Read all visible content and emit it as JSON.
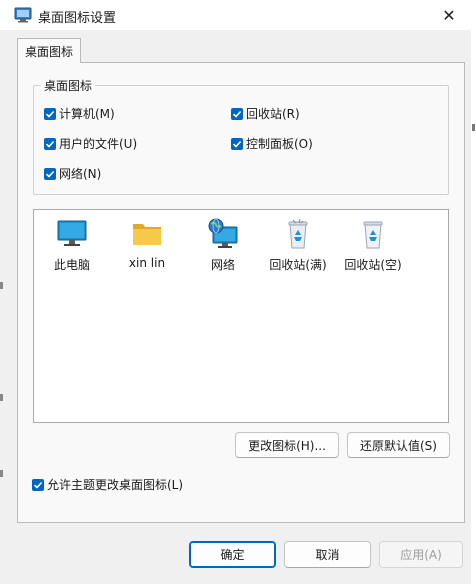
{
  "window": {
    "title": "桌面图标设置",
    "close_glyph": "✕"
  },
  "tabs": [
    {
      "label": "桌面图标"
    }
  ],
  "desktop_icons_group": {
    "legend": "桌面图标",
    "checkboxes": [
      {
        "label": "计算机(M)",
        "checked": true
      },
      {
        "label": "回收站(R)",
        "checked": true
      },
      {
        "label": "用户的文件(U)",
        "checked": true
      },
      {
        "label": "控制面板(O)",
        "checked": true
      },
      {
        "label": "网络(N)",
        "checked": true
      }
    ]
  },
  "icon_list": [
    {
      "label": "此电脑",
      "icon": "monitor-icon"
    },
    {
      "label": "xin lin",
      "icon": "folder-icon"
    },
    {
      "label": "网络",
      "icon": "network-globe-icon"
    },
    {
      "label": "回收站(满)",
      "icon": "recycle-bin-full-icon"
    },
    {
      "label": "回收站(空)",
      "icon": "recycle-bin-empty-icon"
    }
  ],
  "buttons": {
    "change_icon": "更改图标(H)...",
    "restore_default": "还原默认值(S)",
    "ok": "确定",
    "cancel": "取消",
    "apply": "应用(A)"
  },
  "allow_themes": {
    "label": "允许主题更改桌面图标(L)",
    "checked": true
  },
  "colors": {
    "accent": "#0067c0",
    "folder": "#f3c042",
    "monitor": "#1e8fc8"
  }
}
